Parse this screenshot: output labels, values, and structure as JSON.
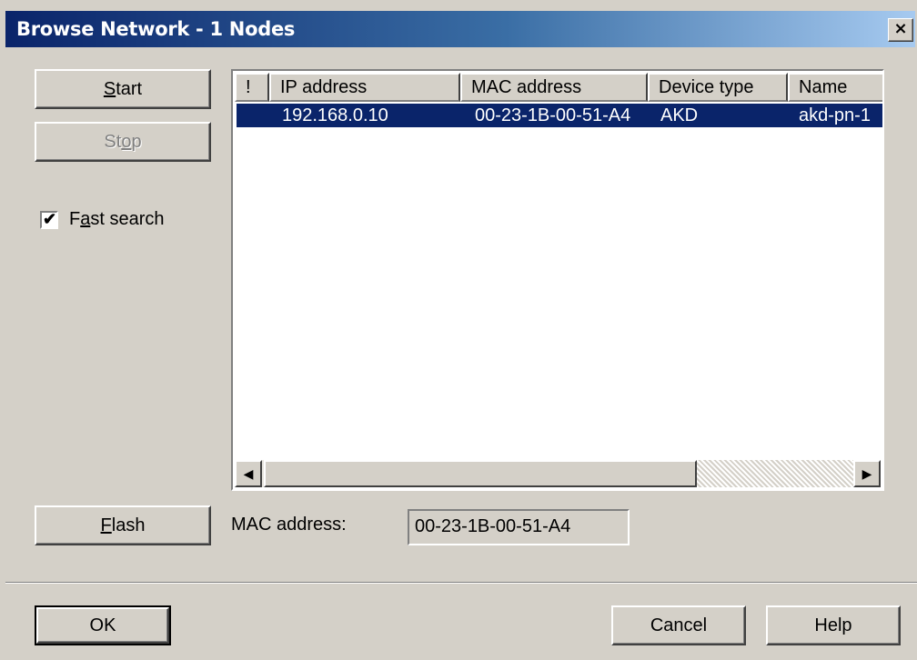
{
  "window": {
    "title": "Browse Network - 1 Nodes",
    "close_glyph": "×"
  },
  "buttons": {
    "start": {
      "label": "Start",
      "accel": "S",
      "rest": "tart"
    },
    "stop": {
      "label": "Stop",
      "accel_pre": "St",
      "accel": "o",
      "rest": "p"
    },
    "flash": {
      "label": "Flash",
      "accel": "F",
      "rest": "lash"
    },
    "ok": "OK",
    "cancel": "Cancel",
    "help": "Help"
  },
  "fast_search": {
    "checked": true,
    "label_pre": "F",
    "label_accel": "a",
    "label_rest": "st search"
  },
  "table": {
    "columns": [
      "!",
      "IP address",
      "MAC address",
      "Device type",
      "Name"
    ],
    "rows": [
      {
        "flag": "",
        "ip": "192.168.0.10",
        "mac": "00-23-1B-00-51-A4",
        "device_type": "AKD",
        "name": "akd-pn-1",
        "selected": true
      }
    ]
  },
  "mac_address": {
    "label": "MAC address:",
    "value": "00-23-1B-00-51-A4"
  },
  "colors": {
    "selection": "#0a246a",
    "face": "#d4d0c8",
    "title_start": "#0a246a",
    "title_end": "#a6caf0"
  }
}
